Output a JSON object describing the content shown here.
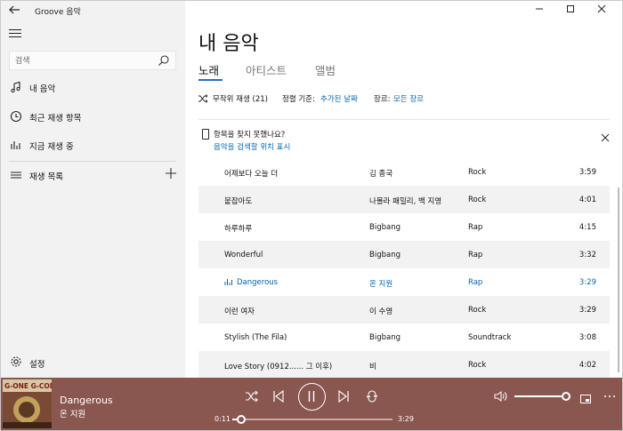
{
  "app": {
    "title": "Groove 음악"
  },
  "sidebar": {
    "search_placeholder": "검색",
    "items": [
      {
        "label": "내 음악",
        "icon": "music-note-icon"
      },
      {
        "label": "최근 재생 항목",
        "icon": "clock-icon"
      },
      {
        "label": "지금 재생 중",
        "icon": "equalizer-icon"
      },
      {
        "label": "재생 목록",
        "icon": "playlist-icon"
      }
    ],
    "settings_label": "설정"
  },
  "main": {
    "title": "내 음악",
    "tabs": [
      {
        "label": "노래",
        "active": true
      },
      {
        "label": "아티스트",
        "active": false
      },
      {
        "label": "앨범",
        "active": false
      }
    ],
    "filters": {
      "shuffle": "무작위 재생 (21)",
      "sort_label": "정렬 기준:",
      "sort_value": "추가된 날짜",
      "genre_label": "장르:",
      "genre_value": "모든 장르"
    },
    "notice": {
      "title": "항목을 찾지 못했나요?",
      "link": "음악을 검색할 위치 표시"
    },
    "songs": [
      {
        "title": "어제보다 오늘 더",
        "artist": "김 종국",
        "genre": "Rock",
        "duration": "3:59"
      },
      {
        "title": "붙잡아도",
        "artist": "나몰라 패밀리, 백 지영",
        "genre": "Rock",
        "duration": "4:01"
      },
      {
        "title": "하루하루",
        "artist": "Bigbang",
        "genre": "Rap",
        "duration": "4:15"
      },
      {
        "title": "Wonderful",
        "artist": "Bigbang",
        "genre": "Rap",
        "duration": "3:32"
      },
      {
        "title": "Dangerous",
        "artist": "온 지원",
        "genre": "Rap",
        "duration": "3:29",
        "playing": true
      },
      {
        "title": "이런 여자",
        "artist": "이 수영",
        "genre": "Rock",
        "duration": "3:29"
      },
      {
        "title": "Stylish (The Fila)",
        "artist": "Bigbang",
        "genre": "Soundtrack",
        "duration": "3:08"
      },
      {
        "title": "Love Story (0912...... 그 이후)",
        "artist": "비",
        "genre": "Rock",
        "duration": "4:02"
      }
    ]
  },
  "player": {
    "album_art_text": "G-ONE G-CODE",
    "track_title": "Dangerous",
    "track_artist": "온 지원",
    "elapsed": "0:11",
    "total": "3:29",
    "progress": 0.053,
    "volume": 1.0
  },
  "colors": {
    "accent": "#0063b1",
    "player_bg": "#8a5750",
    "sidebar_bg": "#f2f2f2"
  }
}
